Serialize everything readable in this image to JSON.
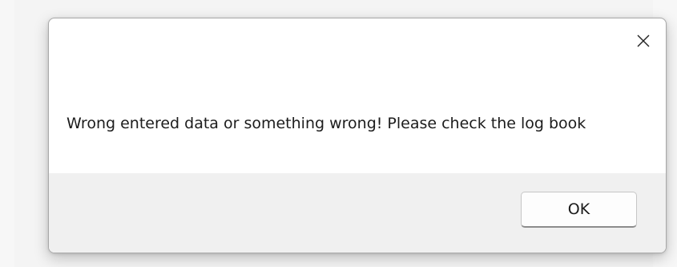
{
  "dialog": {
    "message": "Wrong entered data or something wrong! Please check the log book",
    "close_icon": "close-icon",
    "ok_label": "OK"
  },
  "colors": {
    "dialog_background": "#ffffff",
    "footer_background": "#f0f0f0",
    "text": "#1c1c1c"
  }
}
